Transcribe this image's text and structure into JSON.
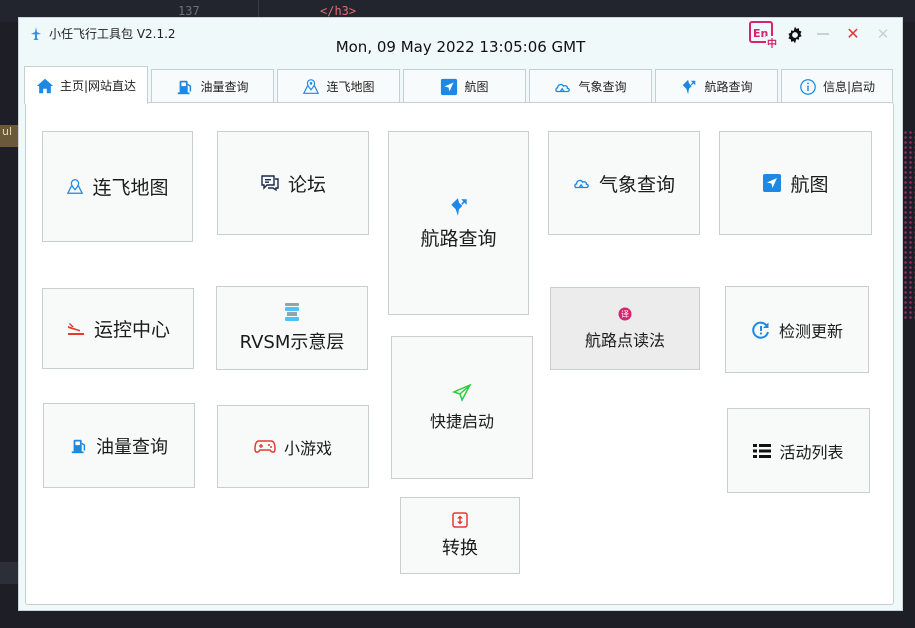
{
  "background": {
    "line_number": "137",
    "code_text": "</h3>",
    "left_marker": "ul"
  },
  "window": {
    "title": "小任飞行工具包 V2.1.2",
    "clock": "Mon, 09 May 2022 13:05:06 GMT",
    "close_symbol": "✕"
  },
  "tabs": [
    {
      "label": "主页|网站直达",
      "icon": "home-icon"
    },
    {
      "label": "油量查询",
      "icon": "fuel-pump-icon"
    },
    {
      "label": "连飞地图",
      "icon": "map-pin-icon"
    },
    {
      "label": "航图",
      "icon": "navigation-arrow-icon"
    },
    {
      "label": "气象查询",
      "icon": "cloud-sun-icon"
    },
    {
      "label": "航路查询",
      "icon": "route-arrows-icon"
    },
    {
      "label": "信息|启动",
      "icon": "info-icon"
    }
  ],
  "tiles": {
    "lianfei_map": "连飞地图",
    "forum": "论坛",
    "route_query": "航路查询",
    "weather_query": "气象查询",
    "chart": "航图",
    "ops_center": "运控中心",
    "rvsm": "RVSM示意层",
    "waypoint_reading": "航路点读法",
    "check_update": "检测更新",
    "quick_launch": "快捷启动",
    "fuel_query": "油量查询",
    "mini_game": "小游戏",
    "activity_list": "活动列表",
    "convert": "转换"
  },
  "colors": {
    "accent_blue": "#1e88e5",
    "lang_pink": "#d6246e",
    "close_red": "#e03a3a",
    "green": "#2ecc40"
  }
}
